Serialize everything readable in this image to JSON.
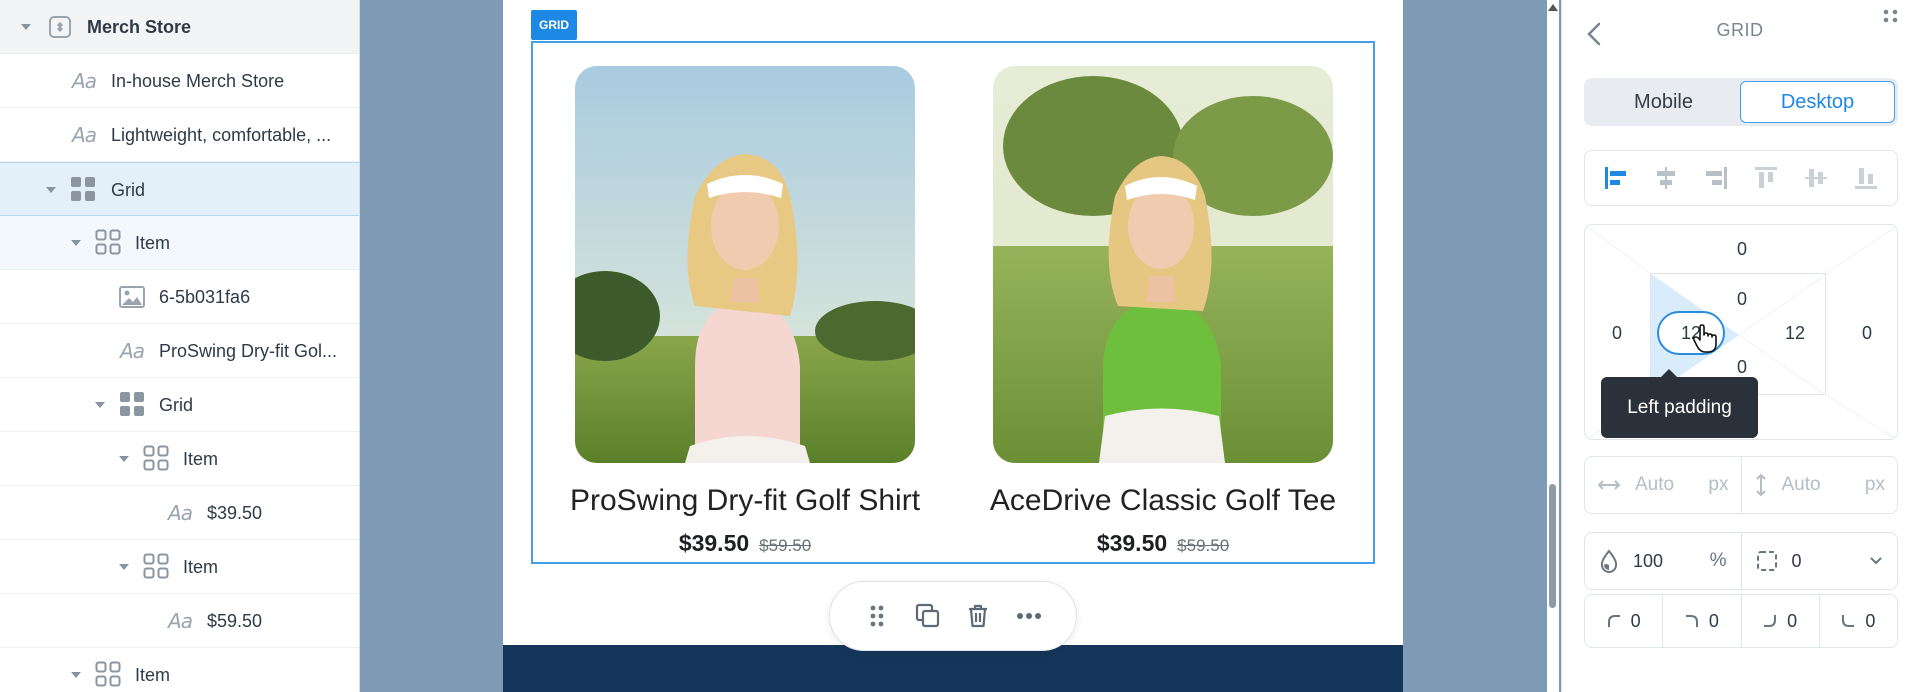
{
  "layers": [
    {
      "label": "Merch Store",
      "type": "component",
      "level": 0,
      "caret": true
    },
    {
      "label": "In-house Merch Store",
      "type": "text",
      "level": 1,
      "caret": false
    },
    {
      "label": "Lightweight, comfortable, ...",
      "type": "text",
      "level": 1,
      "caret": false
    },
    {
      "label": "Grid",
      "type": "grid",
      "level": 1,
      "caret": true,
      "state": "selected"
    },
    {
      "label": "Item",
      "type": "grid",
      "level": 2,
      "caret": true,
      "state": "hovered"
    },
    {
      "label": "6-5b031fa6",
      "type": "image",
      "level": 3,
      "caret": false
    },
    {
      "label": "ProSwing Dry-fit Gol...",
      "type": "text",
      "level": 3,
      "caret": false
    },
    {
      "label": "Grid",
      "type": "grid",
      "level": 3,
      "caret": true
    },
    {
      "label": "Item",
      "type": "grid",
      "level": 4,
      "caret": true
    },
    {
      "label": "$39.50",
      "type": "text",
      "level": 5,
      "caret": false
    },
    {
      "label": "Item",
      "type": "grid",
      "level": 4,
      "caret": true
    },
    {
      "label": "$59.50",
      "type": "text",
      "level": 5,
      "caret": false
    },
    {
      "label": "Item",
      "type": "grid",
      "level": 2,
      "caret": true
    }
  ],
  "canvas": {
    "badge": "GRID",
    "products": [
      {
        "title": "ProSwing Dry-fit Golf Shirt",
        "price": "$39.50",
        "old_price": "$59.50",
        "shirt_color": "#f5d6d0"
      },
      {
        "title": "AceDrive Classic Golf Tee",
        "price": "$39.50",
        "old_price": "$59.50",
        "shirt_color": "#6fbf3f"
      }
    ]
  },
  "props": {
    "title": "GRID",
    "devices": [
      "Mobile",
      "Desktop"
    ],
    "active_device": "Desktop",
    "spacing": {
      "margin_top": "0",
      "margin_left": "0",
      "margin_right": "0",
      "padding_top": "0",
      "padding_left": "12",
      "padding_right": "12",
      "padding_bottom": "0"
    },
    "tooltip": "Left padding",
    "width": {
      "placeholder": "Auto",
      "unit": "px"
    },
    "height": {
      "placeholder": "Auto",
      "unit": "px"
    },
    "opacity": {
      "value": "100",
      "unit": "%"
    },
    "border": {
      "value": "0"
    },
    "radius": [
      "0",
      "0",
      "0",
      "0"
    ]
  },
  "colors": {
    "accent": "#1e88e5",
    "footer": "#15365a",
    "canvas_bg": "#7f9ab4"
  }
}
